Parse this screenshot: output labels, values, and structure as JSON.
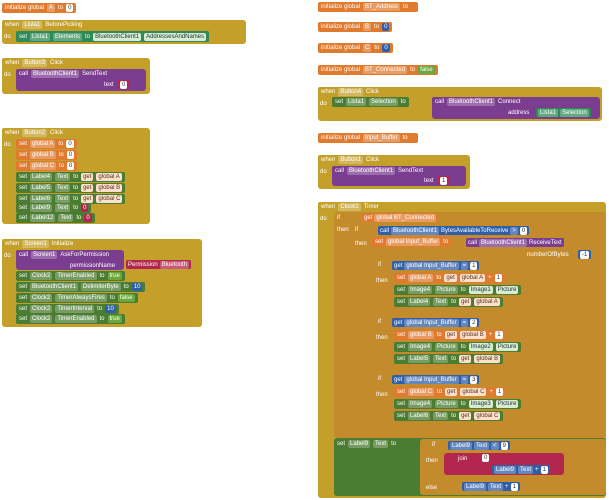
{
  "colors": {
    "event": "#c4a02a",
    "variable": "#e07a2e",
    "component": "#2e8b57",
    "call": "#7a3d8f",
    "control": "#c38b2c",
    "text": "#b3264d",
    "math": "#2f5fa8",
    "logic": "#6aa83d"
  },
  "kw": {
    "init": "initialize global",
    "to": "to",
    "when": "when",
    "do": "do",
    "set": "set",
    "call": "call",
    "get": "get",
    "if": "if",
    "then": "then",
    "else": "else",
    "join": "join"
  },
  "left": {
    "init_A": {
      "name": "A",
      "value": "0"
    },
    "listpicker": {
      "component": "Lista1",
      "event": "BeforePicking",
      "prop": "Elements",
      "target": "BluetoothClient1",
      "value": "AddressesAndNames"
    },
    "button3": {
      "component": "Button3",
      "event": "Click",
      "call": "BluetoothClient1",
      "method": "SendText",
      "param": "text",
      "value": "0"
    },
    "button2": {
      "component": "Button2",
      "event": "Click",
      "vars": [
        {
          "name": "global A",
          "v": "0"
        },
        {
          "name": "global B",
          "v": "0"
        },
        {
          "name": "global C",
          "v": "0"
        }
      ],
      "labels": [
        {
          "l": "Label4",
          "p": "Text",
          "g": "global A"
        },
        {
          "l": "Label5",
          "p": "Text",
          "g": "global B"
        },
        {
          "l": "Label6",
          "p": "Text",
          "g": "global C"
        },
        {
          "l": "Label9",
          "p": "Text",
          "v": "0"
        },
        {
          "l": "Label12",
          "p": "Text",
          "v": "0"
        }
      ]
    },
    "screen1": {
      "component": "Screen1",
      "event": "Initialize",
      "call": "Screen1",
      "method": "AskForPermission",
      "param": "permissionName",
      "perm": "Permission",
      "permVal": "Bluetooth",
      "rows": [
        {
          "c": "Clock2",
          "p": "TimerEnabled",
          "v": "true"
        },
        {
          "c": "BluetoothClient1",
          "p": "DelimiterByte",
          "v": "10"
        },
        {
          "c": "Clock2",
          "p": "TimerAlwaysFires",
          "v": "false"
        },
        {
          "c": "Clock2",
          "p": "TimerInterval",
          "v": "10"
        },
        {
          "c": "Clock2",
          "p": "TimerEnabled",
          "v": "true"
        }
      ]
    }
  },
  "right": {
    "inits": [
      {
        "name": "BT_Address",
        "v": " ",
        "t": "txt"
      },
      {
        "name": "B",
        "v": "0",
        "t": "mth"
      },
      {
        "name": "C",
        "v": "0",
        "t": "mth"
      },
      {
        "name": "BT_Connected",
        "v": "false",
        "t": "lgc"
      }
    ],
    "button4": {
      "component": "Button4",
      "event": "Click",
      "target": "Lista1",
      "prop": "Selection",
      "call": "BluetoothClient1",
      "method": "Connect",
      "param": "address",
      "arg": "Lista1",
      "argp": "Selection"
    },
    "init_buffer": {
      "name": "Input_Buffer",
      "v": " "
    },
    "button1": {
      "component": "Button1",
      "event": "Click",
      "call": "BluetoothClient1",
      "method": "SendText",
      "param": "text",
      "value": "1"
    },
    "clock1": {
      "component": "Clock1",
      "event": "Timer",
      "cond": "global BT_Connected",
      "bytes": {
        "call": "BluetoothClient1",
        "method": "BytesAvailableToReceive",
        "op": ">",
        "v": "0"
      },
      "recv": {
        "var": "global Input_Buffer",
        "call": "BluetoothClient1",
        "method": "ReceiveText",
        "param": "numberOfBytes",
        "v": "-1"
      },
      "branches": [
        {
          "cmp": "=",
          "v": "1",
          "g": "global A",
          "img": "Image4",
          "pic": "Picture",
          "src": "Image1",
          "lab": "Label4",
          "gv": "global A"
        },
        {
          "cmp": "=",
          "v": "2",
          "g": "global B",
          "img": "Image4",
          "pic": "Picture",
          "src": "Image2",
          "lab": "Label5",
          "gv": "global B"
        },
        {
          "cmp": "=",
          "v": "3",
          "g": "global C",
          "img": "Image4",
          "pic": "Picture",
          "src": "Image3",
          "lab": "Label6",
          "gv": "global C"
        }
      ],
      "buf": "global Input_Buffer",
      "plus": "+",
      "one": "1",
      "text": "Text",
      "last": {
        "lab": "Label9",
        "p": "Text",
        "cmp": "<",
        "v": "9",
        "join": "0",
        "plus": "+",
        "one": "1"
      }
    }
  }
}
